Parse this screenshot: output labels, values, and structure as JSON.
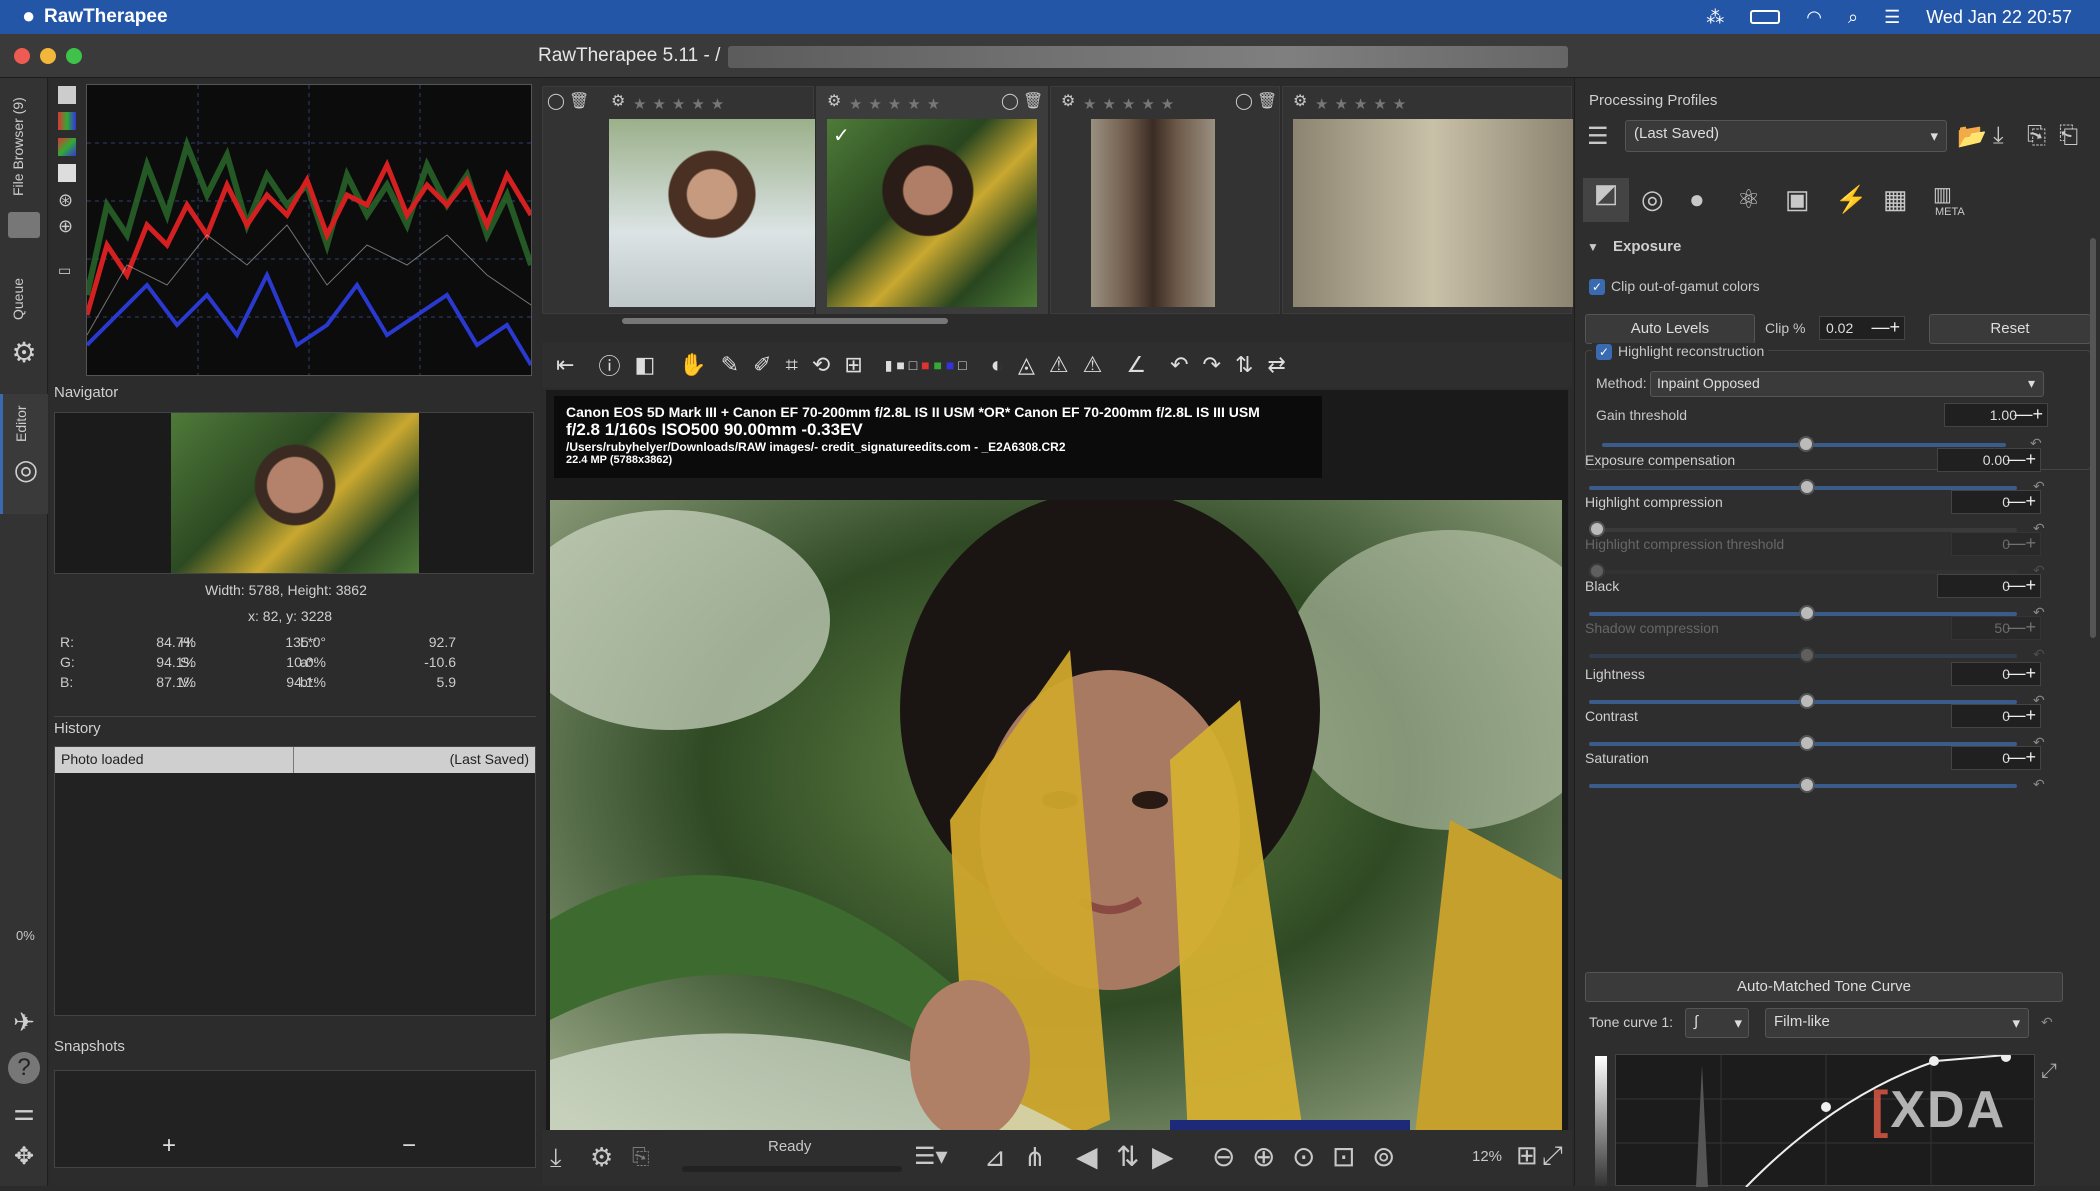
{
  "menubar": {
    "app_name": "RawTherapee",
    "datetime": "Wed Jan 22  20:57"
  },
  "window": {
    "title": "RawTherapee 5.11 - /"
  },
  "side_tabs": {
    "file_browser": "File Browser (9)",
    "queue": "Queue",
    "editor": "Editor",
    "progress": "0%"
  },
  "navigator": {
    "title": "Navigator",
    "size_text": "Width: 5788, Height: 3862",
    "coords": "x: 82, y: 3228",
    "values": [
      {
        "a": "R:",
        "b": "84.7%",
        "c": "H:",
        "d": "135.0°",
        "e": "L*:",
        "f": "92.7"
      },
      {
        "a": "G:",
        "b": "94.1%",
        "c": "S:",
        "d": "10.0%",
        "e": "a*:",
        "f": "-10.6"
      },
      {
        "a": "B:",
        "b": "87.1%",
        "c": "V:",
        "d": "94.1%",
        "e": "b*:",
        "f": "5.9"
      }
    ]
  },
  "history": {
    "title": "History",
    "row_action": "Photo loaded",
    "row_profile": "(Last Saved)"
  },
  "snapshots": {
    "title": "Snapshots",
    "add": "+",
    "remove": "−"
  },
  "filmstrip": {
    "stars": "★★★★★"
  },
  "image": {
    "exif_line1": "Canon EOS 5D Mark III + Canon EF 70-200mm f/2.8L IS II USM *OR* Canon EF 70-200mm f/2.8L IS III USM",
    "exif_line2": "f/2.8  1/160s  ISO500  90.00mm  -0.33EV",
    "exif_line3": "/Users/rubyhelyer/Downloads/RAW images/- credit_signatureedits.com - _E2A6308.CR2",
    "exif_line4": "22.4 MP (5788x3862)"
  },
  "statusbar": {
    "status": "Ready",
    "zoom": "12%"
  },
  "right": {
    "processing_profiles": "Processing Profiles",
    "profile_value": "(Last Saved)",
    "meta_tab": "META",
    "exposure_title": "Exposure",
    "clip_gamut": "Clip out-of-gamut colors",
    "auto_levels": "Auto Levels",
    "clip_label": "Clip %",
    "clip_value": "0.02",
    "reset": "Reset",
    "highlight_recon": "Highlight reconstruction",
    "method_label": "Method:",
    "method_value": "Inpaint Opposed",
    "gain_threshold": "Gain threshold",
    "gain_value": "1.00",
    "sliders": [
      {
        "label": "Exposure compensation",
        "value": "0.00"
      },
      {
        "label": "Highlight compression",
        "value": "0"
      },
      {
        "label": "Highlight compression threshold",
        "value": "0"
      },
      {
        "label": "Black",
        "value": "0"
      },
      {
        "label": "Shadow compression",
        "value": "50"
      },
      {
        "label": "Lightness",
        "value": "0"
      },
      {
        "label": "Contrast",
        "value": "0"
      },
      {
        "label": "Saturation",
        "value": "0"
      }
    ],
    "tone_curve_btn": "Auto-Matched Tone Curve",
    "tone_curve_label": "Tone curve 1:",
    "tone_curve_mode": "Film-like"
  },
  "watermark": "XDA",
  "colors": {
    "menubar": "#2456a8",
    "accent": "#3a6ab0",
    "panel": "#2e2e2e"
  }
}
